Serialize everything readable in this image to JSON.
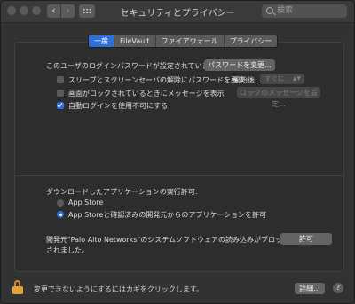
{
  "window": {
    "title": "セキュリティとプライバシー",
    "back_glyph": "‹",
    "forward_glyph": "›",
    "search_placeholder": "検索"
  },
  "tabs": [
    {
      "label": "一般",
      "active": true
    },
    {
      "label": "FileVault",
      "active": false
    },
    {
      "label": "ファイアウォール",
      "active": false
    },
    {
      "label": "プライバシー",
      "active": false
    }
  ],
  "general": {
    "password_set_text": "このユーザのログインパスワードが設定されています",
    "change_password_button": "パスワードを変更...",
    "require_password_label": "スリープとスクリーンセーバの解除にパスワードを要求",
    "require_password_checked": false,
    "start_after_label": "開始後:",
    "start_after_value": "すぐに",
    "lock_message_label": "画面がロックされているときにメッセージを表示",
    "lock_message_checked": false,
    "lock_message_button": "ロックのメッセージを設定...",
    "disable_autologin_label": "自動ログインを使用不可にする",
    "disable_autologin_checked": true
  },
  "downloads": {
    "heading": "ダウンロードしたアプリケーションの実行許可:",
    "options": [
      {
        "label": "App Store",
        "selected": false
      },
      {
        "label": "App Storeと確認済みの開発元からのアプリケーションを許可",
        "selected": true
      }
    ]
  },
  "blocked": {
    "message_line1": "開発元\"Palo Alto Networks\"のシステムソフトウェアの読み込みがブロック",
    "message_line2": "されました。",
    "allow_button": "許可"
  },
  "footer": {
    "lock_text": "変更できないようにするにはカギをクリックします。",
    "advanced_button": "詳細...",
    "help_glyph": "?"
  },
  "colors": {
    "accent": "#2e6fd9",
    "lock": "#e3a33b",
    "background": "#323232"
  },
  "icons": [
    "back-arrow-icon",
    "forward-arrow-icon",
    "grid-icon",
    "search-icon",
    "checkmark-icon",
    "lock-icon",
    "help-icon"
  ]
}
